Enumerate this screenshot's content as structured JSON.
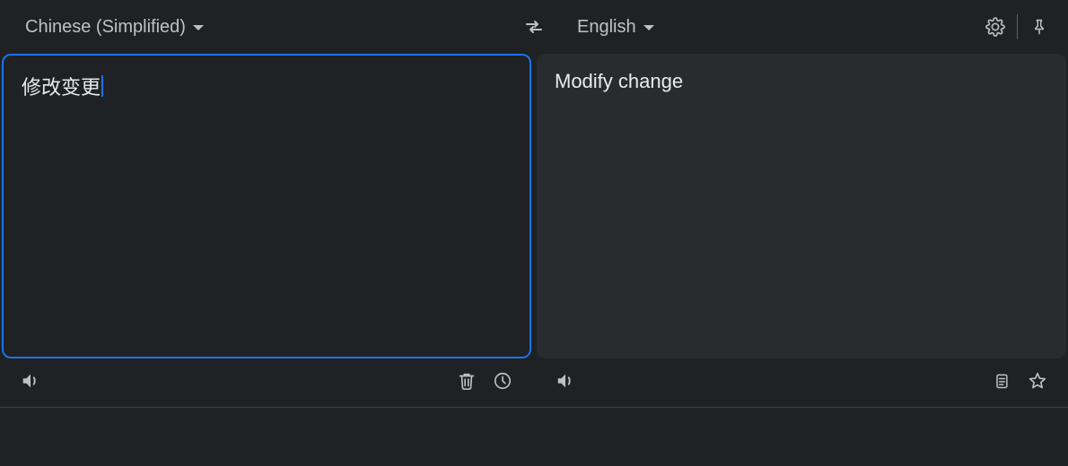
{
  "header": {
    "source_lang": "Chinese (Simplified)",
    "target_lang": "English"
  },
  "source": {
    "text": "修改变更"
  },
  "target": {
    "text": "Modify change"
  }
}
